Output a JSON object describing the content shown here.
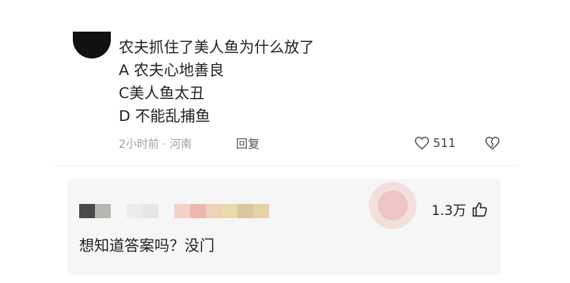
{
  "comment1": {
    "lines": [
      "农夫抓住了美人鱼为什么放了",
      "A 农夫心地善良",
      "C美人鱼太丑",
      "D 不能乱捕鱼"
    ],
    "meta": "2小时前 · 河南",
    "reply_label": "回复",
    "like_count": "511"
  },
  "comment2": {
    "like_count": "1.3万",
    "text": "想知道答案吗？没门"
  },
  "icons": [
    "heart-outline-icon",
    "broken-heart-icon",
    "thumbs-up-icon"
  ],
  "colors": {
    "meta_gray": "#a0a0a0",
    "text": "#222222",
    "panel_bg": "#f6f6f6"
  }
}
